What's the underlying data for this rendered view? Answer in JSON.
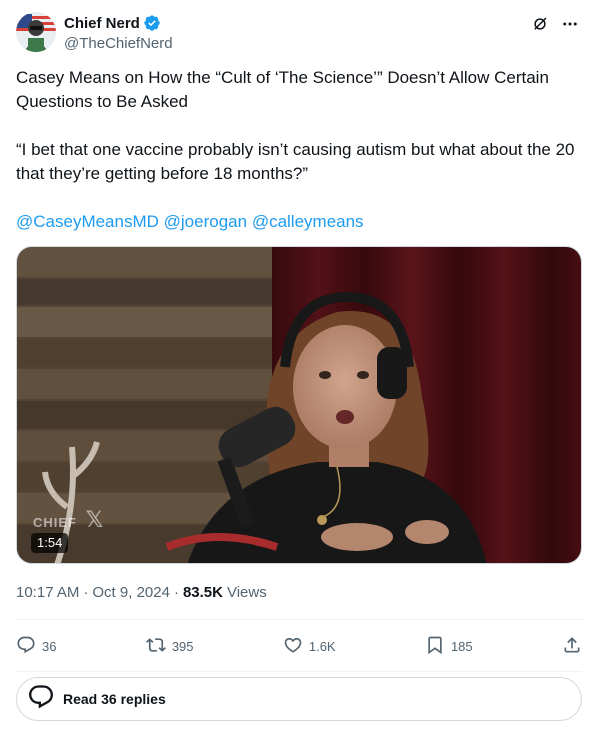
{
  "author": {
    "display_name": "Chief Nerd",
    "handle": "@TheChiefNerd"
  },
  "tweet": {
    "paragraph1": "Casey Means on How the “Cult of ‘The Science’” Doesn’t Allow Certain Questions to Be Asked",
    "paragraph2": "“I bet that one vaccine probably isn’t causing autism but what about the 20 that they’re getting before 18 months?”",
    "mentions": [
      "@CaseyMeansMD",
      "@joerogan",
      "@calleymeans"
    ]
  },
  "media": {
    "watermark": "CHIEF",
    "duration": "1:54"
  },
  "meta": {
    "time": "10:17 AM",
    "separator1": "·",
    "date": "Oct 9, 2024",
    "separator2": "·",
    "views_count": "83.5K",
    "views_label": "Views"
  },
  "actions": {
    "replies": "36",
    "reposts": "395",
    "likes": "1.6K",
    "bookmarks": "185"
  },
  "read_replies": {
    "label": "Read 36 replies"
  },
  "colors": {
    "link": "#1d9bf0",
    "verified": "#1d9bf0",
    "muted": "#536471",
    "text": "#0f1419"
  }
}
